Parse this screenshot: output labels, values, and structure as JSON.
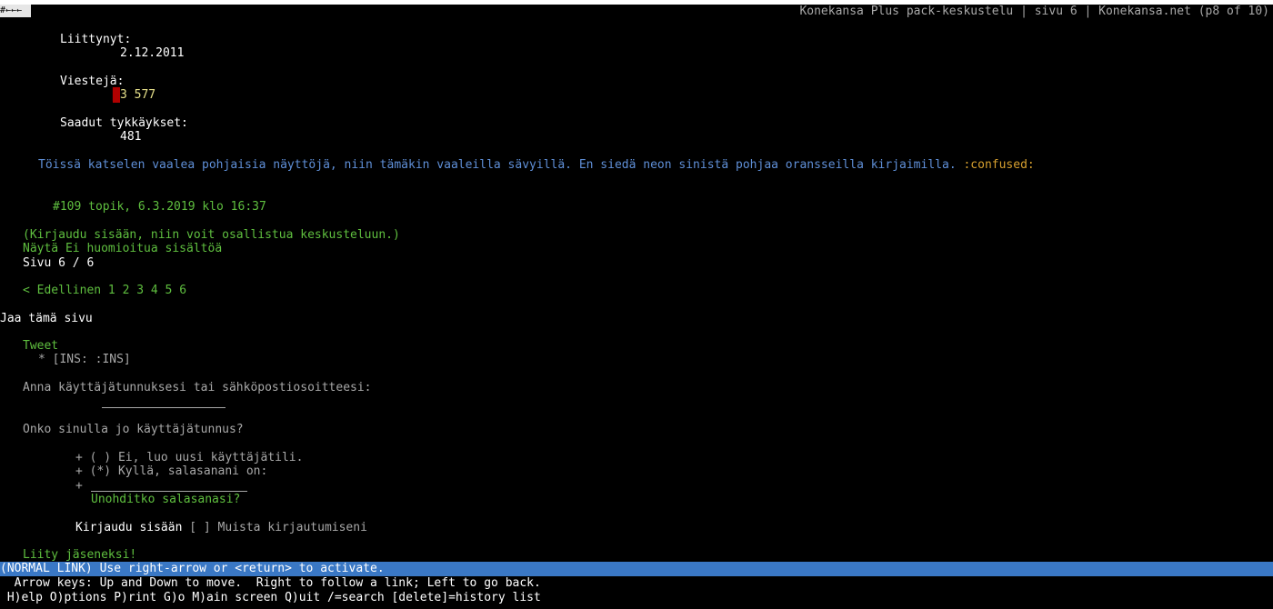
{
  "header": {
    "nav_glyph": "#←←←",
    "title": "Konekansa Plus pack-keskustelu | sivu 6 | Konekansa.net (p8 of 10)"
  },
  "profile": {
    "joined_label": "Liittynyt:",
    "joined_value": "2.12.2011",
    "posts_label": "Viestejä:",
    "posts_value": "3 577",
    "likes_label": "Saadut tykkäykset:",
    "likes_value": "481"
  },
  "post": {
    "body": "Töissä katselen vaalea pohjaisia näyttöjä, niin tämäkin vaaleilla sävyillä. En siedä neon sinistä pohjaa oransseilla kirjaimilla.",
    "emoticon": ":confused:",
    "next_post_link": "#109 topik, 6.3.2019 klo 16:37"
  },
  "forum": {
    "login_prompt": "(Kirjaudu sisään, niin voit osallistua keskusteluun.)",
    "show_ignored": "Näytä Ei huomioitua sisältöä",
    "page_indicator": "Sivu 6 / 6",
    "pagination": {
      "prev": "< Edellinen",
      "pages": [
        "1",
        "2",
        "3",
        "4",
        "5",
        "6"
      ]
    },
    "share_label": "Jaa tämä sivu",
    "tweet": "Tweet",
    "ins": "* [INS: :INS]"
  },
  "login_form": {
    "username_label": "Anna käyttäjätunnuksesi tai sähköpostiosoitteesi:",
    "have_account_q": "Onko sinulla jo käyttäjätunnus?",
    "option_new": "+ ( ) Ei, luo uusi käyttäjätili.",
    "option_yes": "+ (*) Kyllä, salasanani on:",
    "option_plus": "+",
    "forgot_password": "Unohditko salasanasi?",
    "login_button": "Kirjaudu sisään",
    "remember_me": "[ ] Muista kirjautumiseni",
    "register": "Liity jäseneksi!"
  },
  "status": {
    "link_status": "(NORMAL LINK) Use right-arrow or <return> to activate.",
    "help_line1": "  Arrow keys: Up and Down to move.  Right to follow a link; Left to go back.",
    "help_line2": " H)elp O)ptions P)rint G)o M)ain screen Q)uit /=search [delete]=history list"
  },
  "colors": {
    "background": "#000000",
    "link": "#5fbf3f",
    "quote": "#5f8fd7",
    "status_bar": "#3a78c5"
  }
}
